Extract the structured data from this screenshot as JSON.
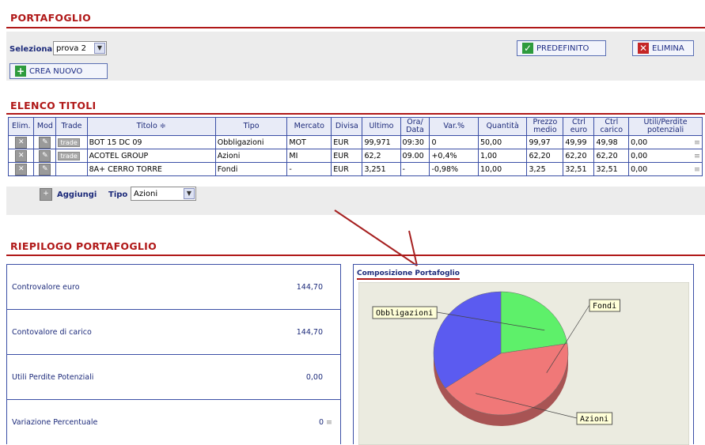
{
  "portfolio": {
    "title": "PORTAFOGLIO",
    "select_label": "Seleziona",
    "select_value": "prova 2",
    "predefinito": "PREDEFINITO",
    "elimina": "ELIMINA",
    "crea_nuovo": "CREA NUOVO"
  },
  "elenco": {
    "title": "ELENCO TITOLI",
    "headers": [
      "Elim.",
      "Mod",
      "Trade",
      "Titolo ≑",
      "Tipo",
      "Mercato",
      "Divisa",
      "Ultimo",
      "Ora/ Data",
      "Var.%",
      "Quantità",
      "Prezzo medio",
      "Ctrl euro",
      "Ctrl carico",
      "Utili/Perdite potenziali"
    ],
    "trade_label": "trade",
    "rows": [
      {
        "trade": true,
        "titolo": "BOT 15 DC 09",
        "tipo": "Obbligazioni",
        "mercato": "MOT",
        "divisa": "EUR",
        "ultimo": "99,971",
        "ora": "09:30",
        "var": "0",
        "quantita": "50,00",
        "prezzo": "99,97",
        "ctrl_euro": "49,99",
        "ctrl_carico": "49,98",
        "utili": "0,00"
      },
      {
        "trade": true,
        "titolo": "ACOTEL GROUP",
        "tipo": "Azioni",
        "mercato": "MI",
        "divisa": "EUR",
        "ultimo": "62,2",
        "ora": "09.00",
        "var": "+0,4%",
        "quantita": "1,00",
        "prezzo": "62,20",
        "ctrl_euro": "62,20",
        "ctrl_carico": "62,20",
        "utili": "0,00"
      },
      {
        "trade": false,
        "titolo": "8A+ CERRO TORRE",
        "tipo": "Fondi",
        "mercato": "-",
        "divisa": "EUR",
        "ultimo": "3,251",
        "ora": "-",
        "var": "-0,98%",
        "quantita": "10,00",
        "prezzo": "3,25",
        "ctrl_euro": "32,51",
        "ctrl_carico": "32,51",
        "utili": "0,00"
      }
    ],
    "aggiungi": "Aggiungi",
    "tipo_label": "Tipo",
    "tipo_value": "Azioni"
  },
  "riepilogo": {
    "title": "RIEPILOGO PORTAFOGLIO",
    "rows": [
      {
        "label": "Controvalore euro",
        "value": "144,70"
      },
      {
        "label": "Contovalore di carico",
        "value": "144,70"
      },
      {
        "label": "Utili Perdite Potenziali",
        "value": "0,00"
      },
      {
        "label": "Variazione Percentuale",
        "value": "0"
      }
    ],
    "chart_title": "Composizione Portafoglio"
  },
  "chart_data": {
    "type": "pie",
    "title": "",
    "slices": [
      {
        "label": "Obbligazioni",
        "value": 49.99,
        "color": "#5b5bf0"
      },
      {
        "label": "Azioni",
        "value": 62.2,
        "color": "#f07878"
      },
      {
        "label": "Fondi",
        "value": 32.51,
        "color": "#5ef06a"
      }
    ]
  }
}
